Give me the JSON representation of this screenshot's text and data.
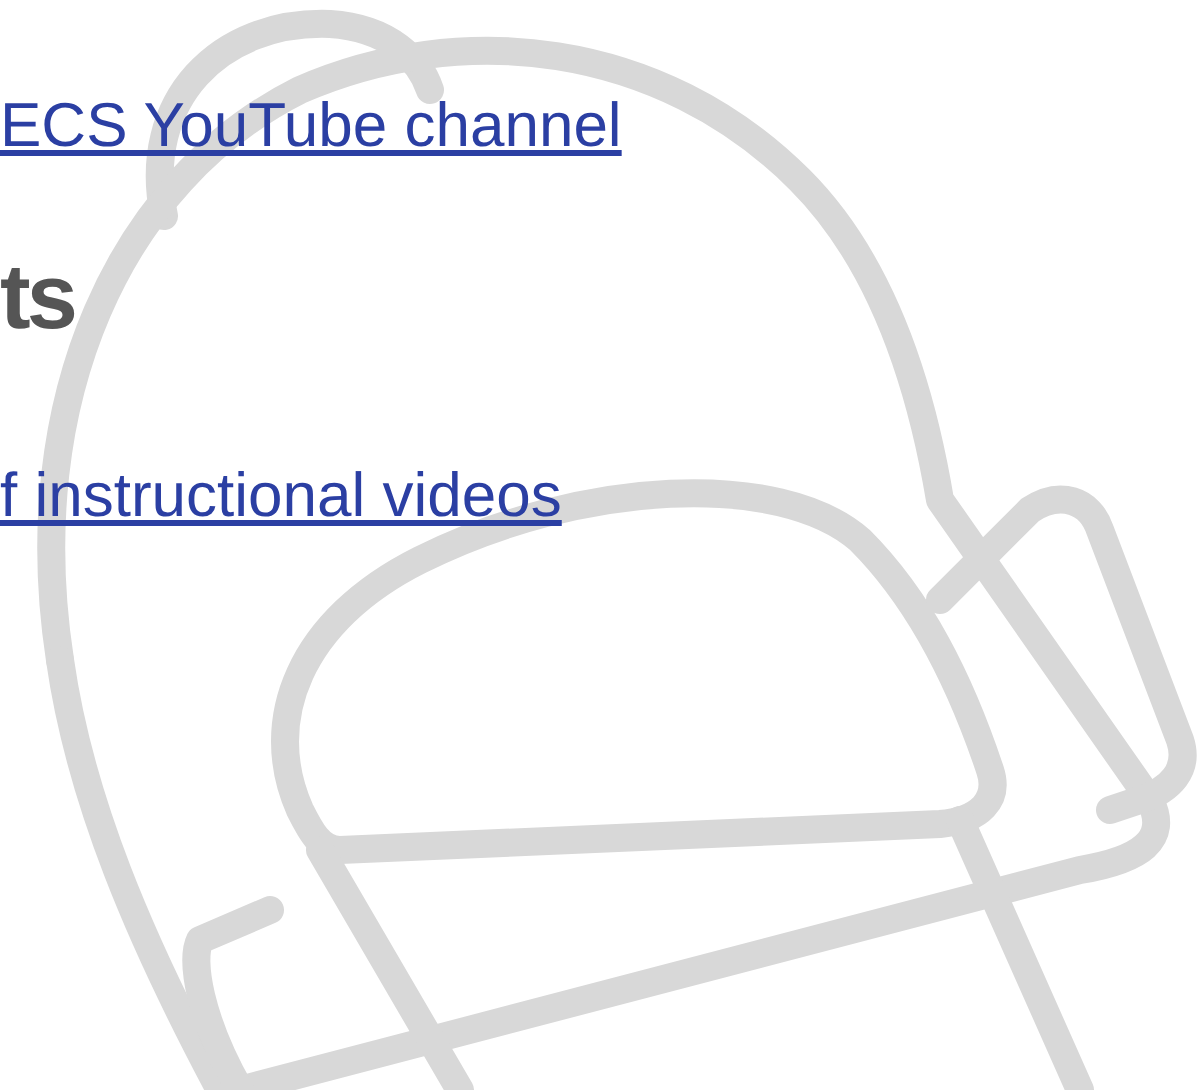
{
  "links_top": {
    "text": "ECS YouTube channel"
  },
  "heading": {
    "text": "ts"
  },
  "links_bottom": {
    "text": "f instructional videos"
  }
}
